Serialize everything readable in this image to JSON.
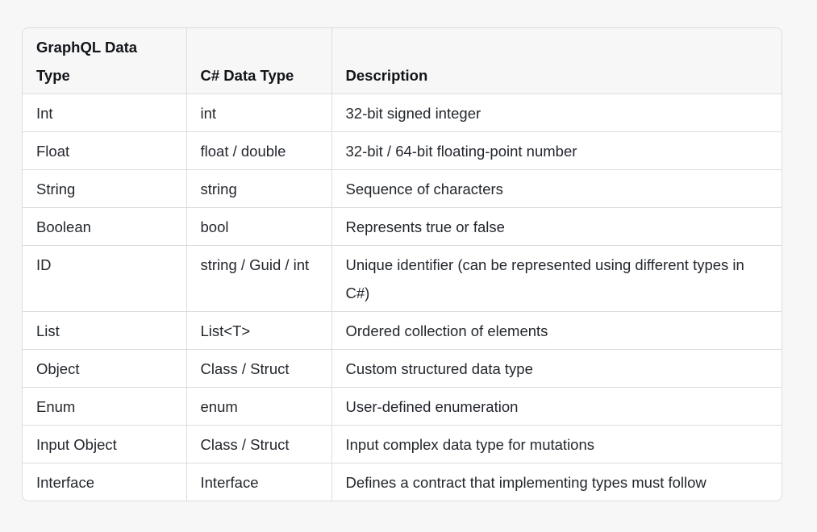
{
  "table": {
    "headers": [
      "GraphQL Data Type",
      "C# Data Type",
      "Description"
    ],
    "rows": [
      [
        "Int",
        "int",
        "32-bit signed integer"
      ],
      [
        "Float",
        "float / double",
        "32-bit / 64-bit floating-point number"
      ],
      [
        "String",
        "string",
        "Sequence of characters"
      ],
      [
        "Boolean",
        "bool",
        "Represents true or false"
      ],
      [
        "ID",
        "string / Guid / int",
        "Unique identifier (can be represented using different types in C#)"
      ],
      [
        "List",
        "List<T>",
        "Ordered collection of elements"
      ],
      [
        "Object",
        "Class / Struct",
        "Custom structured data type"
      ],
      [
        "Enum",
        "enum",
        "User-defined enumeration"
      ],
      [
        "Input Object",
        "Class / Struct",
        "Input complex data type for mutations"
      ],
      [
        "Interface",
        "Interface",
        "Defines a contract that implementing types must follow"
      ]
    ]
  }
}
